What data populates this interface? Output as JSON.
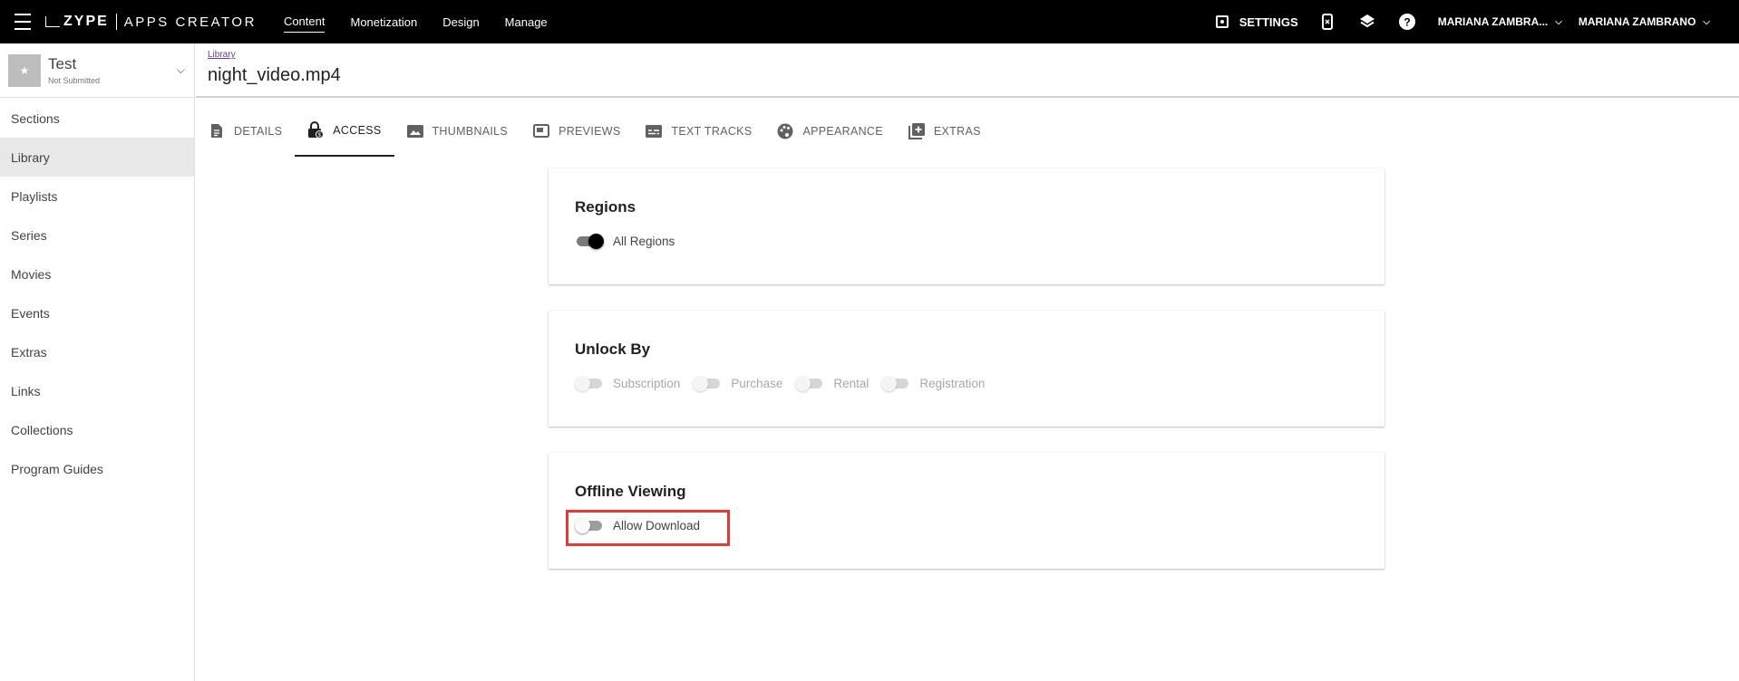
{
  "topbar": {
    "logo_brand": "ZYPE",
    "logo_product": "APPS CREATOR",
    "nav": [
      "Content",
      "Monetization",
      "Design",
      "Manage"
    ],
    "settings_label": "SETTINGS",
    "user_account": "MARIANA ZAMBRA...",
    "user_name": "MARIANA ZAMBRANO"
  },
  "sidebar": {
    "app_name": "Test",
    "app_status": "Not Submitted",
    "items": [
      "Sections",
      "Library",
      "Playlists",
      "Series",
      "Movies",
      "Events",
      "Extras",
      "Links",
      "Collections",
      "Program Guides"
    ],
    "active_item": "Library"
  },
  "header": {
    "breadcrumb": "Library",
    "title": "night_video.mp4"
  },
  "tabs": [
    "DETAILS",
    "ACCESS",
    "THUMBNAILS",
    "PREVIEWS",
    "TEXT TRACKS",
    "APPEARANCE",
    "EXTRAS"
  ],
  "active_tab": "ACCESS",
  "regions": {
    "title": "Regions",
    "toggle_label": "All Regions",
    "toggle_on": true
  },
  "unlock_by": {
    "title": "Unlock By",
    "options": [
      "Subscription",
      "Purchase",
      "Rental",
      "Registration"
    ],
    "disabled": true
  },
  "offline": {
    "title": "Offline Viewing",
    "toggle_label": "Allow Download",
    "toggle_on": false
  },
  "colors": {
    "topbar_bg": "#000000",
    "highlight": "#e53935",
    "breadcrumb": "#6a3d9a"
  }
}
